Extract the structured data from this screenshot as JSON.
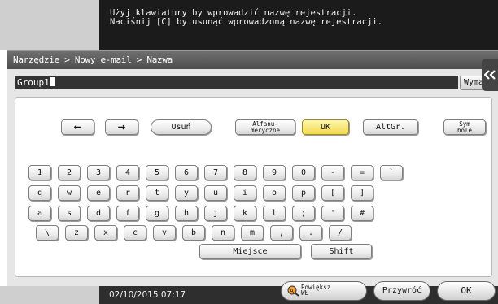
{
  "message": {
    "line1": "Użyj klawiatury by wprowadzić nazwę rejestracji.",
    "line2": "Naciśnij [C] by usunąć wprowadzoną nazwę rejestracji."
  },
  "breadcrumb": "Narzędzie > Nowy e-mail > Nazwa",
  "input": {
    "value": "Group1"
  },
  "clear_label": "Wymaż",
  "keys": {
    "left_arrow": "←",
    "right_arrow": "→",
    "delete": "Usuń",
    "alnum_line1": "Alfanu-",
    "alnum_line2": "meryczne",
    "uk": "UK",
    "altgr": "AltGr.",
    "symbols_line1": "Sym",
    "symbols_line2": "bole",
    "row1": [
      "1",
      "2",
      "3",
      "4",
      "5",
      "6",
      "7",
      "8",
      "9",
      "0",
      "-",
      "=",
      "`"
    ],
    "row2": [
      "q",
      "w",
      "e",
      "r",
      "t",
      "y",
      "u",
      "i",
      "o",
      "p",
      "[",
      "]"
    ],
    "row3": [
      "a",
      "s",
      "d",
      "f",
      "g",
      "h",
      "j",
      "k",
      "l",
      ";",
      "'",
      "#"
    ],
    "row4": [
      "\\",
      "z",
      "x",
      "c",
      "v",
      "b",
      "n",
      "m",
      ",",
      ".",
      "/"
    ],
    "space": "Miejsce",
    "shift": "Shift"
  },
  "footer": {
    "datetime": "02/10/2015  07:17",
    "zoom_line1": "Powiększ",
    "zoom_line2": "WŁ",
    "reset": "Przywróć",
    "ok": "OK"
  },
  "colors": {
    "active_key": "#f2d94a",
    "header_bar": "#1b1b1b"
  },
  "icons": {
    "side_tab": "double-chevron-left-icon",
    "zoom": "magnifier-text-icon"
  }
}
